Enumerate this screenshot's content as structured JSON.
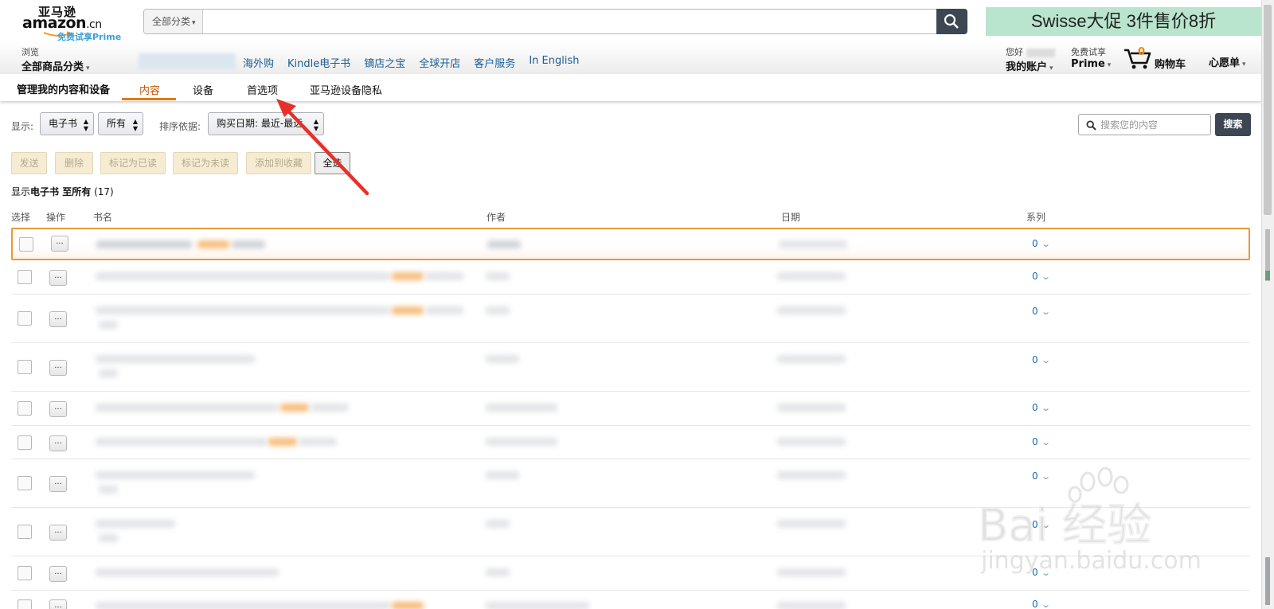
{
  "header": {
    "logo_cn": "亚马逊",
    "logo_main": "amazon",
    "logo_tld": ".cn",
    "logo_prime": "免费试享Prime",
    "search_category": "全部分类",
    "search_placeholder": "",
    "banner_text": "Swisse大促 3件售价8折",
    "browse_small": "浏览",
    "browse_big": "全部商品分类",
    "nav_links": [
      "海外购",
      "Kindle电子书",
      "镝店之宝",
      "全球开店",
      "客户服务",
      "In English"
    ],
    "hello_small": "您好",
    "account_big": "我的账户",
    "prime_small": "免费试享",
    "prime_big": "Prime",
    "cart_count": "0",
    "cart_label": "购物车",
    "wishlist": "心愿单"
  },
  "subnav": {
    "title": "管理我的内容和设备",
    "tabs": [
      "内容",
      "设备",
      "首选项",
      "亚马逊设备隐私"
    ],
    "active_tab": "内容"
  },
  "controls": {
    "show_label": "显示:",
    "type_select": "电子书",
    "scope_select": "所有",
    "sort_label": "排序依据:",
    "sort_select": "购买日期: 最近-最远",
    "search_placeholder": "搜索您的内容",
    "search_button": "搜索"
  },
  "actions": [
    "发送",
    "删除",
    "标记为已读",
    "标记为未读",
    "添加到收藏",
    "全选"
  ],
  "showing": {
    "prefix": "显示",
    "type": "电子书",
    "mid": " 至",
    "scope": "所有",
    "count": "(17)"
  },
  "table": {
    "headers": [
      "选择",
      "操作",
      "书名",
      "作者",
      "日期",
      "系列"
    ],
    "action_button": "...",
    "rows": [
      {
        "series": "0"
      },
      {
        "series": "0"
      },
      {
        "series": "0"
      },
      {
        "series": "0"
      },
      {
        "series": "0"
      },
      {
        "series": "0"
      },
      {
        "series": "0"
      },
      {
        "series": "0"
      },
      {
        "series": "0"
      },
      {
        "series": "0"
      }
    ]
  },
  "watermark": {
    "big": "Bai 经验",
    "small": "jingyan.baidu.com"
  },
  "colors": {
    "accent_orange": "#e47911",
    "link_blue": "#1a6fb3",
    "dark_button": "#3d4653",
    "annotation_red": "#e8302a"
  }
}
